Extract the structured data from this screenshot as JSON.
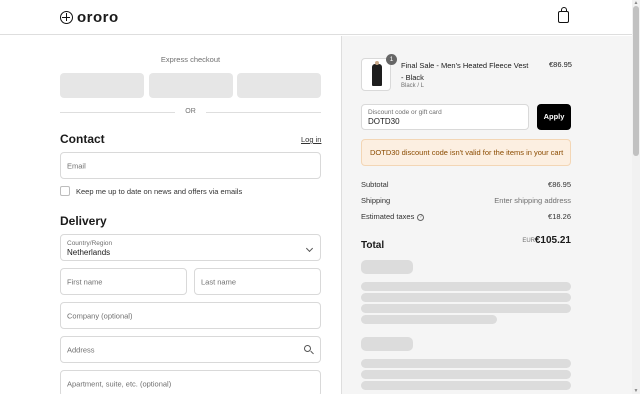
{
  "header": {
    "brand": "ororo",
    "logo_icon": "ororo-logo-icon",
    "cart_icon": "shopping-bag-icon"
  },
  "express": {
    "label": "Express checkout",
    "or": "OR"
  },
  "contact": {
    "title": "Contact",
    "login_link": "Log in",
    "email_placeholder": "Email",
    "newsletter_label": "Keep me up to date on news and offers via emails"
  },
  "delivery": {
    "title": "Delivery",
    "country_label": "Country/Region",
    "country_value": "Netherlands",
    "first_name_placeholder": "First name",
    "last_name_placeholder": "Last name",
    "company_placeholder": "Company (optional)",
    "address_placeholder": "Address",
    "apartment_placeholder": "Apartment, suite, etc. (optional)"
  },
  "order": {
    "quantity": "1",
    "product_name": "Final Sale - Men's Heated Fleece Vest - Black",
    "product_variant": "Black / L",
    "product_price": "€86.95"
  },
  "discount": {
    "label": "Discount code or gift card",
    "value": "DOTD30",
    "apply": "Apply",
    "error": "DOTD30 discount code isn't valid for the items in your cart"
  },
  "summary": {
    "subtotal_label": "Subtotal",
    "subtotal_value": "€86.95",
    "shipping_label": "Shipping",
    "shipping_value": "Enter shipping address",
    "taxes_label": "Estimated taxes",
    "taxes_value": "€18.26",
    "total_label": "Total",
    "currency": "EUR",
    "total_value": "€105.21"
  }
}
